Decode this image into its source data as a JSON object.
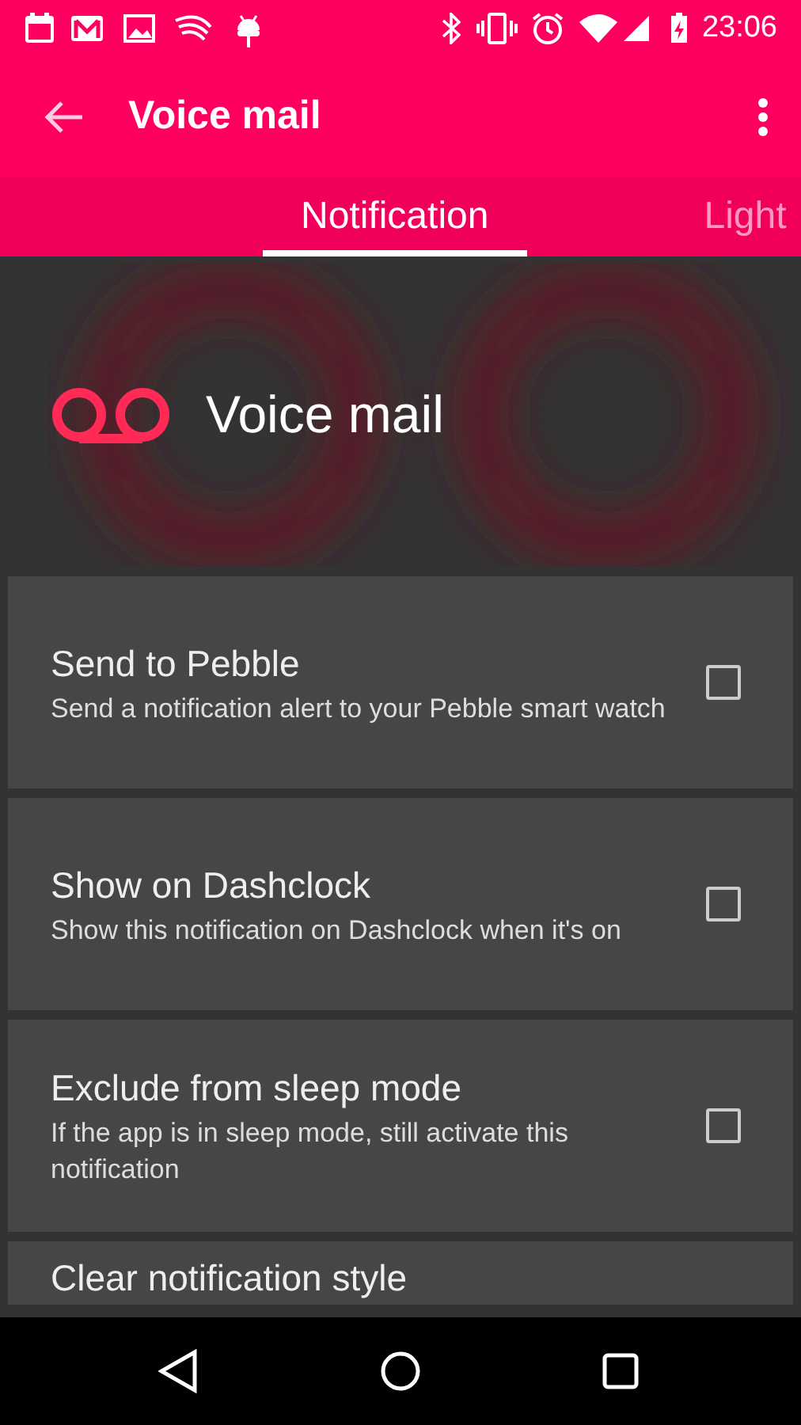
{
  "status_bar": {
    "time": "23:06"
  },
  "app_bar": {
    "title": "Voice mail"
  },
  "tabs": [
    {
      "label": "Notification",
      "selected": true
    },
    {
      "label": "Light",
      "selected": false
    }
  ],
  "header": {
    "title": "Voice mail"
  },
  "settings": [
    {
      "title": "Send to Pebble",
      "description": "Send a notification alert to your Pebble smart watch",
      "checked": false
    },
    {
      "title": "Show on Dashclock",
      "description": "Show this notification on Dashclock when it's on",
      "checked": false
    },
    {
      "title": "Exclude from sleep mode",
      "description": "If the app is in sleep mode, still activate this notification",
      "checked": false
    },
    {
      "title": "Clear notification style"
    }
  ]
}
